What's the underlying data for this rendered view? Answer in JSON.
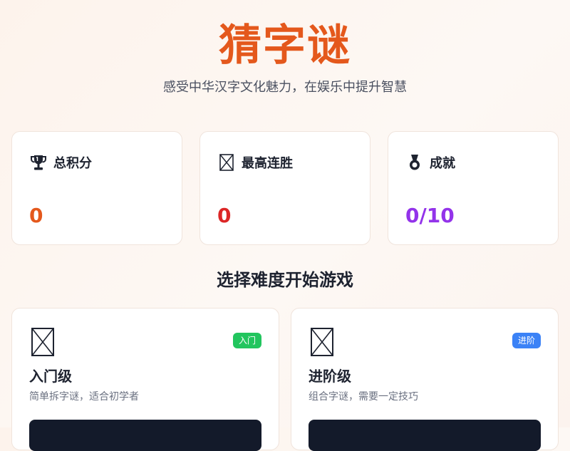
{
  "header": {
    "title": "猜字谜",
    "subtitle": "感受中华汉字文化魅力，在娱乐中提升智慧"
  },
  "stats": {
    "score": {
      "label": "总积分",
      "value": "0",
      "icon": "trophy-icon",
      "color": "#e4581c"
    },
    "streak": {
      "label": "最高连胜",
      "value": "0",
      "icon": "missing-glyph-icon",
      "color": "#dc2626"
    },
    "achievements": {
      "label": "成就",
      "value": "0/10",
      "icon": "medal-icon",
      "color": "#9333ea"
    }
  },
  "section": {
    "title": "选择难度开始游戏"
  },
  "levels": [
    {
      "icon": "missing-glyph-icon",
      "badge": "入门",
      "badge_color": "#22c55e",
      "name": "入门级",
      "description": "简单拆字谜，适合初学者"
    },
    {
      "icon": "missing-glyph-icon",
      "badge": "进阶",
      "badge_color": "#3b82f6",
      "name": "进阶级",
      "description": "组合字谜，需要一定技巧"
    }
  ],
  "colors": {
    "accent": "#e4581c",
    "button_dark": "#131a2a"
  }
}
